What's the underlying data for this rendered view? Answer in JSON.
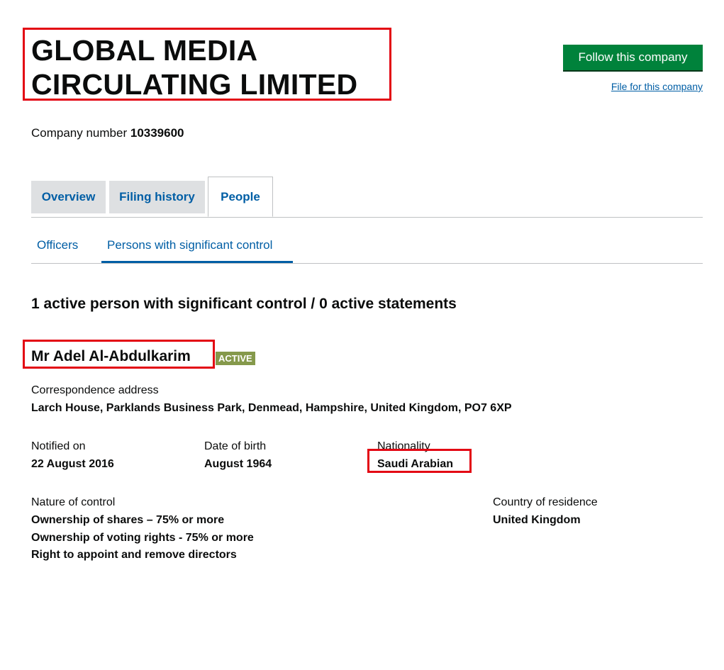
{
  "header": {
    "title_line1": "GLOBAL MEDIA",
    "title_line2": "CIRCULATING LIMITED",
    "follow_label": "Follow this company",
    "file_link": "File for this company"
  },
  "company": {
    "number_label": "Company number",
    "number": "10339600"
  },
  "tabs": [
    {
      "label": "Overview"
    },
    {
      "label": "Filing history"
    },
    {
      "label": "People"
    }
  ],
  "subtabs": [
    {
      "label": "Officers"
    },
    {
      "label": "Persons with significant control"
    }
  ],
  "summary": "1 active person with significant control / 0 active statements",
  "person": {
    "name": "Mr Adel Al-Abdulkarim",
    "status": "ACTIVE",
    "address_label": "Correspondence address",
    "address": "Larch House, Parklands Business Park, Denmead, Hampshire, United Kingdom, PO7 6XP",
    "notified_label": "Notified on",
    "notified": "22 August 2016",
    "dob_label": "Date of birth",
    "dob": "August 1964",
    "nationality_label": "Nationality",
    "nationality": "Saudi Arabian",
    "control_label": "Nature of control",
    "controls": [
      "Ownership of shares – 75% or more",
      "Ownership of voting rights - 75% or more",
      "Right to appoint and remove directors"
    ],
    "residence_label": "Country of residence",
    "residence": "United Kingdom"
  },
  "colors": {
    "link": "#005ea5",
    "button": "#00823b",
    "badge": "#85994b",
    "highlight": "#e30613"
  }
}
